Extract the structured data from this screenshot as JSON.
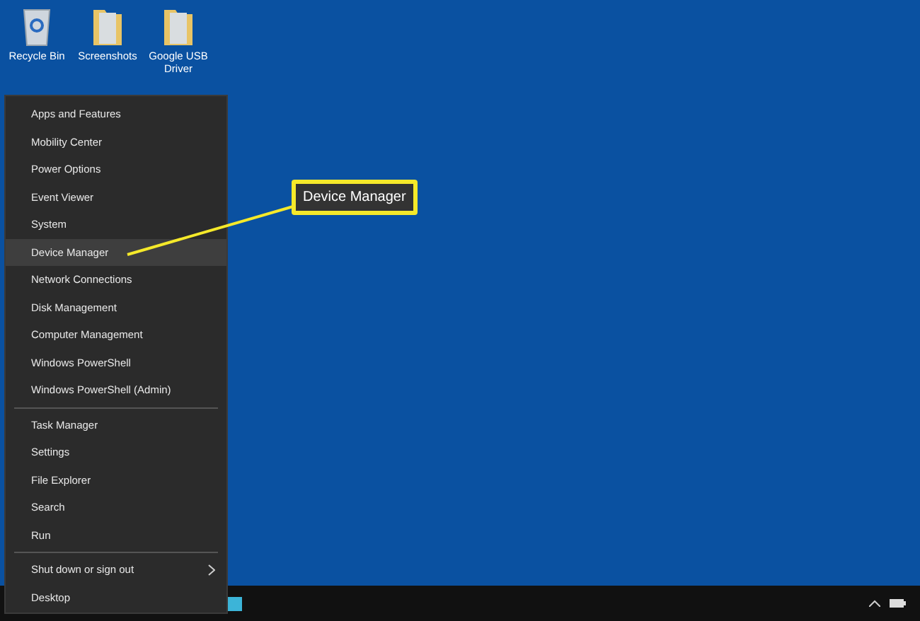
{
  "desktop_icons": [
    {
      "label": "Recycle Bin",
      "kind": "bin"
    },
    {
      "label": "Screenshots",
      "kind": "folder"
    },
    {
      "label": "Google USB Driver",
      "kind": "folder"
    }
  ],
  "menu": {
    "groups": [
      {
        "items": [
          {
            "label": "Apps and Features",
            "selected": false
          },
          {
            "label": "Mobility Center",
            "selected": false
          },
          {
            "label": "Power Options",
            "selected": false
          },
          {
            "label": "Event Viewer",
            "selected": false
          },
          {
            "label": "System",
            "selected": false
          },
          {
            "label": "Device Manager",
            "selected": true
          },
          {
            "label": "Network Connections",
            "selected": false
          },
          {
            "label": "Disk Management",
            "selected": false
          },
          {
            "label": "Computer Management",
            "selected": false
          },
          {
            "label": "Windows PowerShell",
            "selected": false
          },
          {
            "label": "Windows PowerShell (Admin)",
            "selected": false
          }
        ]
      },
      {
        "items": [
          {
            "label": "Task Manager",
            "selected": false
          },
          {
            "label": "Settings",
            "selected": false
          },
          {
            "label": "File Explorer",
            "selected": false
          },
          {
            "label": "Search",
            "selected": false
          },
          {
            "label": "Run",
            "selected": false
          }
        ]
      },
      {
        "items": [
          {
            "label": "Shut down or sign out",
            "selected": false,
            "submenu": true
          },
          {
            "label": "Desktop",
            "selected": false
          }
        ]
      }
    ]
  },
  "callout": {
    "label": "Device Manager"
  }
}
